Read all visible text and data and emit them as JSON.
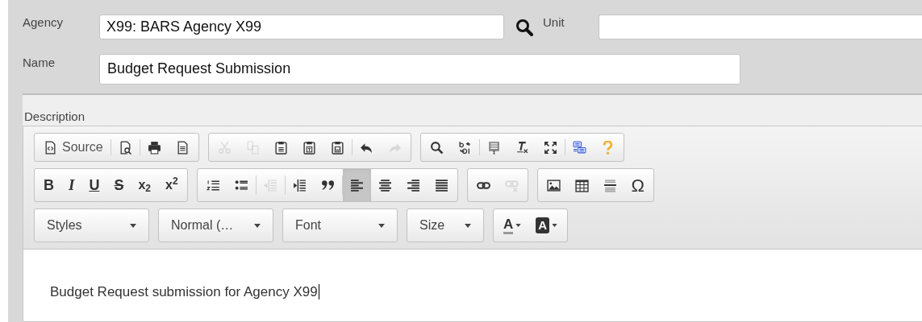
{
  "form": {
    "agency": {
      "label": "Agency",
      "value": "X99: BARS Agency X99"
    },
    "unit": {
      "label": "Unit"
    },
    "name": {
      "label": "Name",
      "value": "Budget Request Submission"
    }
  },
  "description": {
    "label": "Description",
    "toolbar_rows": [
      [
        {
          "buttons": [
            {
              "label": "Source",
              "disabled": false
            },
            {
              "disabled": false
            },
            {
              "disabled": false
            },
            {
              "disabled": false
            }
          ]
        },
        {
          "buttons": [
            {
              "disabled": true
            },
            {
              "disabled": true
            },
            {
              "disabled": false
            },
            {
              "disabled": false
            },
            {
              "disabled": false
            },
            {
              "disabled": false
            },
            {
              "disabled": true
            }
          ]
        },
        {
          "buttons": [
            {
              "disabled": false
            },
            {
              "disabled": false
            },
            {
              "disabled": false
            },
            {
              "disabled": false
            },
            {
              "disabled": false
            },
            {
              "disabled": false
            },
            {
              "disabled": false
            }
          ]
        }
      ],
      [
        {
          "buttons": [
            {
              "label": "B",
              "disabled": false
            },
            {
              "label": "I",
              "disabled": false
            },
            {
              "label": "U",
              "disabled": false
            },
            {
              "label": "S",
              "disabled": false
            },
            {
              "label": "x$_{2}$",
              "disabled": false
            },
            {
              "label": "x$^{2}$",
              "disabled": false
            }
          ]
        },
        {
          "buttons": [
            {
              "disabled": false,
              "selected": false
            },
            {
              "disabled": false,
              "selected": false
            },
            {
              "disabled": true,
              "selected": false
            },
            {
              "disabled": false,
              "selected": false
            },
            {
              "disabled": false,
              "selected": false
            },
            {
              "disabled": false,
              "selected": true
            },
            {
              "disabled": false,
              "selected": false
            },
            {
              "disabled": false,
              "selected": false
            },
            {
              "disabled": false,
              "selected": false
            }
          ]
        },
        {
          "buttons": [
            {
              "disabled": false
            },
            {
              "disabled": true
            }
          ]
        },
        {
          "buttons": [
            {
              "disabled": false
            },
            {
              "disabled": false
            },
            {
              "disabled": false
            },
            {
              "label": "Ω",
              "disabled": false
            }
          ]
        }
      ]
    ],
    "combos": [
      {
        "label": "Styles"
      },
      {
        "label": "Normal (…"
      },
      {
        "label": "Font"
      },
      {
        "label": "Size"
      }
    ],
    "color_buttons": [
      {
        "label": "A"
      },
      {
        "label": "A"
      }
    ],
    "content": "Budget Request submission for Agency X99"
  }
}
